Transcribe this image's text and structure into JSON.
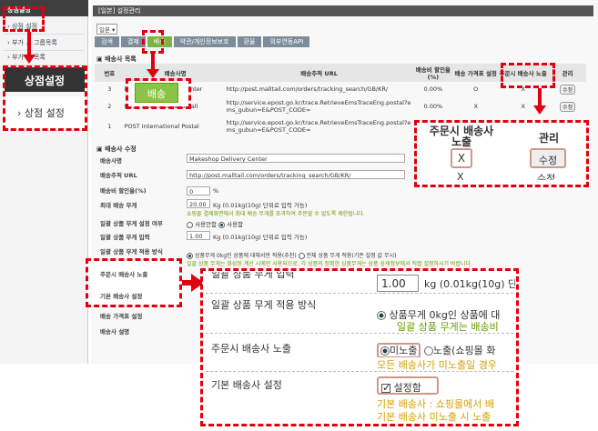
{
  "sidebar": {
    "header": "상점설정",
    "items": [
      "› 상점 설정",
      "› 부가 ... 그룹목록",
      "› 부가 ... 목록"
    ],
    "callout_title": "상점설정",
    "callout_item": "› 상점 설정"
  },
  "main": {
    "header": "[일본] 설정관리",
    "lang_select": "일본",
    "tabs": [
      "검색",
      "결제",
      "배송",
      "약관/개인정보보호",
      "환율",
      "외부연동API"
    ],
    "active_tab": "배송",
    "list_title": "배송사 목록",
    "list_columns": [
      "번호",
      "배송사명",
      "배송추적 URL",
      "배송비 할인율 (%)",
      "배송 가격표 설정",
      "주문시 배송사 노출",
      "관리"
    ],
    "list_rows": [
      {
        "no": "3",
        "name": "Makeshop Delivery Center",
        "url": "http://post.malltail.com/orders/tracking_search/GB/KR/",
        "discount": "0.00%",
        "price": "O",
        "expose": "X",
        "manage": "수정"
      },
      {
        "no": "2",
        "name": "POST International Small",
        "url": "http://service.epost.go.kr/trace.RetrieveEmsTraceEng.postal?ems_gubun=E&POST_CODE=",
        "discount": "0.00%",
        "price": "X",
        "expose": "X",
        "manage": "수정"
      },
      {
        "no": "1",
        "name": "POST International Postal",
        "url": "http://service.epost.go.kr/trace.RetrieveEmsTraceEng.postal?ems_gubun=E&POST_CODE=",
        "discount": "0.00%",
        "price": "O",
        "expose": "X",
        "manage": "수정"
      }
    ],
    "tab_callout": "배송",
    "edit_title": "배송사 수정",
    "form": {
      "name_label": "배송사명",
      "name_value": "Makeshop Delivery Center",
      "url_label": "배송추적 URL",
      "url_value": "http://post.malltail.com/orders/tracking_search/GB/KR/",
      "discount_label": "배송비 할인율(%)",
      "discount_value": "0",
      "discount_unit": "%",
      "maxw_label": "최대 배송 무게",
      "maxw_value": "20.00",
      "maxw_unit": "Kg (0.01kg(10g) 단위로 입력 가능)",
      "maxw_note": "쇼핑몰 결제화면에서 최대 배송 무게를 초과하여 주문할 수 없도록 제한됩니다.",
      "bulk_use_label": "일괄 상품 무게 설정 여부",
      "bulk_use_off": "사용안함",
      "bulk_use_on": "사용함",
      "bulk_input_label": "일괄 상품 무게 입력",
      "bulk_input_value": "1.00",
      "bulk_input_unit": "Kg (0.01kg(10g) 단위로 입력 가능)",
      "bulk_method_label": "일괄 상품 무게 적용 방식",
      "bulk_method_opt1": "상품무게 0kg인 상품에 대해서만 적용(추천)",
      "bulk_method_opt2": "전체 상품 무게 적용(기존 설정 값 무시)",
      "bulk_method_note": "일괄 상품 무게는 화성된 계산 시에만 사용되므로, 각 상품의 정확한 상품무게는 상품 상세정보에서 직접 설정하시기 바랍니다.",
      "expose_label": "주문시 배송사 노출",
      "default_label": "기본 배송사 설정",
      "price_label": "배송 가격표 설정",
      "desc_label": "배송사 설명"
    }
  },
  "callout_manage": {
    "col1": "주문시 배송사 노출",
    "col2": "관리",
    "val1": "X",
    "val2": "수정",
    "val3": "X",
    "val4": "수정"
  },
  "callout_zoom": {
    "row0_label": "일괄 상품 무게 입력",
    "row0_value": "1.00",
    "row0_unit": "kg (0.01kg(10g) 단",
    "row1_label": "일괄 상품 무게 적용 방식",
    "row1_opt": "상품무게 0kg인 상품에 대",
    "row1_note": "일괄 상품 무게는 배송비",
    "row2_label": "주문시 배송사 노출",
    "row2_opt1": "미노출",
    "row2_opt2": "노출(쇼핑몰 화",
    "row2_note": "모든 배송사가 미노출일 경우",
    "row3_label": "기본 배송사 설정",
    "row3_check": "설정함",
    "row3_note1": "기본 배송사 : 쇼핑몰에서 배",
    "row3_note2": "기본 배송사 미노출 시 노출"
  }
}
